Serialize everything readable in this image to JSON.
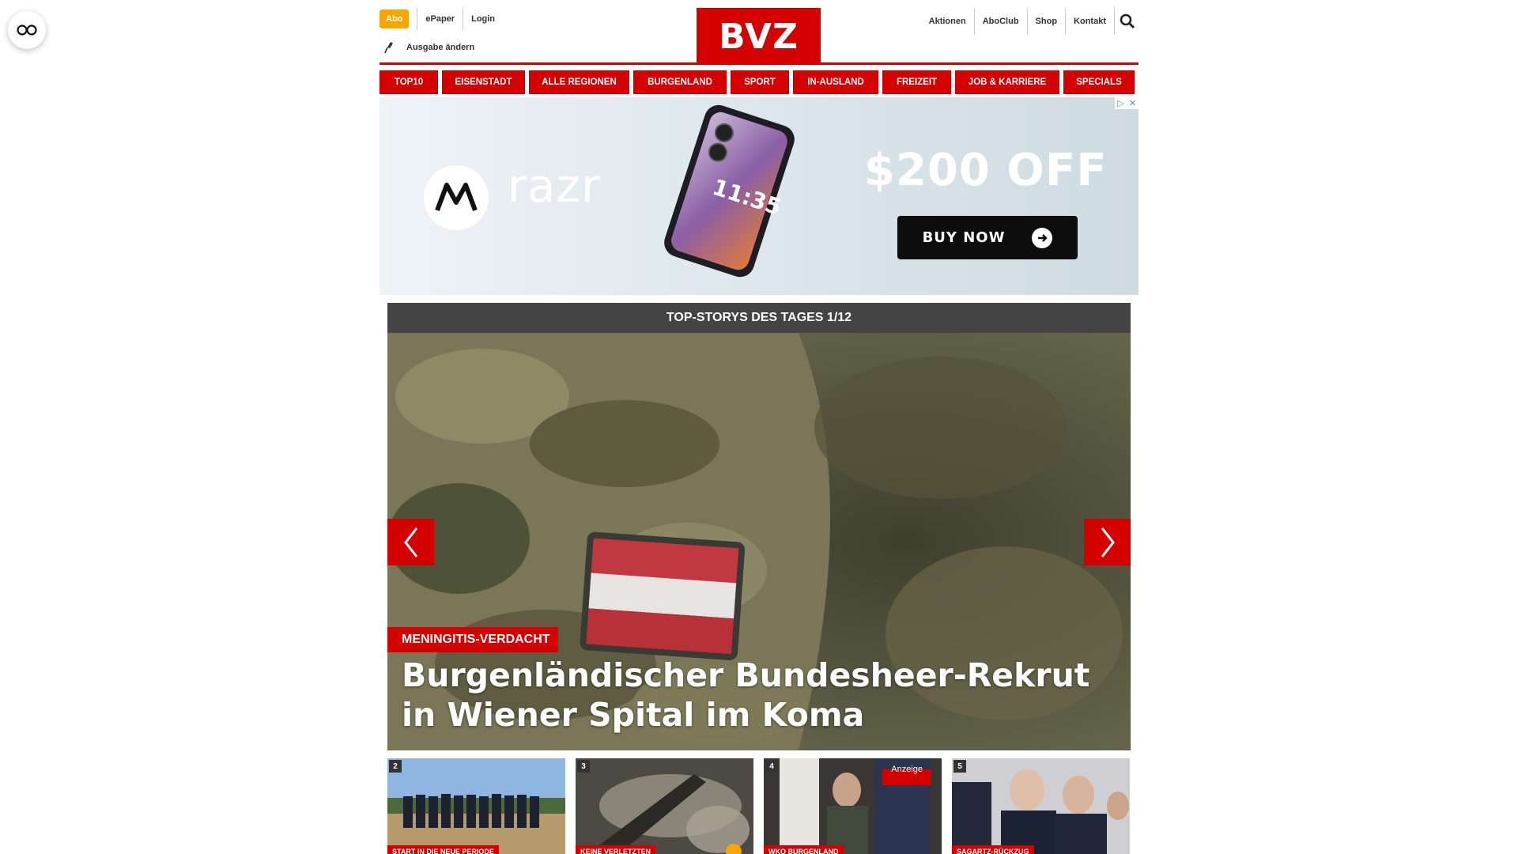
{
  "header": {
    "abo_label": "Abo",
    "links_left": [
      "ePaper",
      "Login"
    ],
    "ausgabe_label": "Ausgabe ändern",
    "logo_text": "BVZ",
    "links_right": [
      "Aktionen",
      "AboClub",
      "Shop",
      "Kontakt"
    ]
  },
  "nav": {
    "items": [
      "TOP10",
      "EISENSTADT",
      "ALLE REGIONEN",
      "BURGENLAND",
      "SPORT",
      "IN-AUSLAND",
      "FREIZEIT",
      "JOB & KARRIERE",
      "SPECIALS"
    ]
  },
  "ad": {
    "brand": "razr",
    "offer": "$200 OFF",
    "cta": "BUY NOW",
    "phone_time": "11:35"
  },
  "stories": {
    "title": "TOP-STORYS DES TAGES 1/12",
    "hero": {
      "kicker": "MENINGITIS-VERDACHT",
      "headline": "Burgenländischer Bundesheer-Rekrut in Wiener Spital im Koma"
    },
    "thumbs": [
      {
        "num": "2",
        "kicker": "START IN DIE NEUE PERIODE"
      },
      {
        "num": "3",
        "kicker": "KEINE VERLETZTEN"
      },
      {
        "num": "4",
        "kicker": "WKO BURGENLAND",
        "badge": "Anzeige"
      },
      {
        "num": "5",
        "kicker": "SAGARTZ-RÜCKZUG"
      }
    ]
  },
  "colors": {
    "brand_red": "#d40000",
    "abo_orange": "#f7a600",
    "stories_header": "#444444"
  }
}
